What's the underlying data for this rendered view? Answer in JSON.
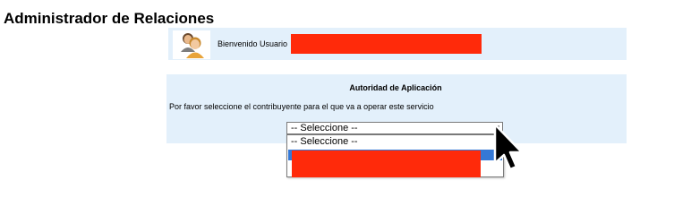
{
  "header": {
    "title": "Administrador de Relaciones"
  },
  "welcome": {
    "text": "Bienvenido Usuario",
    "avatar_icon": "users-icon"
  },
  "authority": {
    "title": "Autoridad de Aplicación",
    "instruction": "Por favor seleccione el contribuyente para el que va a operar este servicio",
    "select": {
      "selected_value": "-- Seleccione --",
      "arrow_icon": "chevron-down-icon",
      "options": [
        "-- Seleccione --"
      ]
    }
  },
  "colors": {
    "panel_bg": "#e3f0fb",
    "redaction": "#ff2a0a",
    "option_highlight": "#3478d6"
  },
  "cursor_icon": "mouse-pointer-icon"
}
